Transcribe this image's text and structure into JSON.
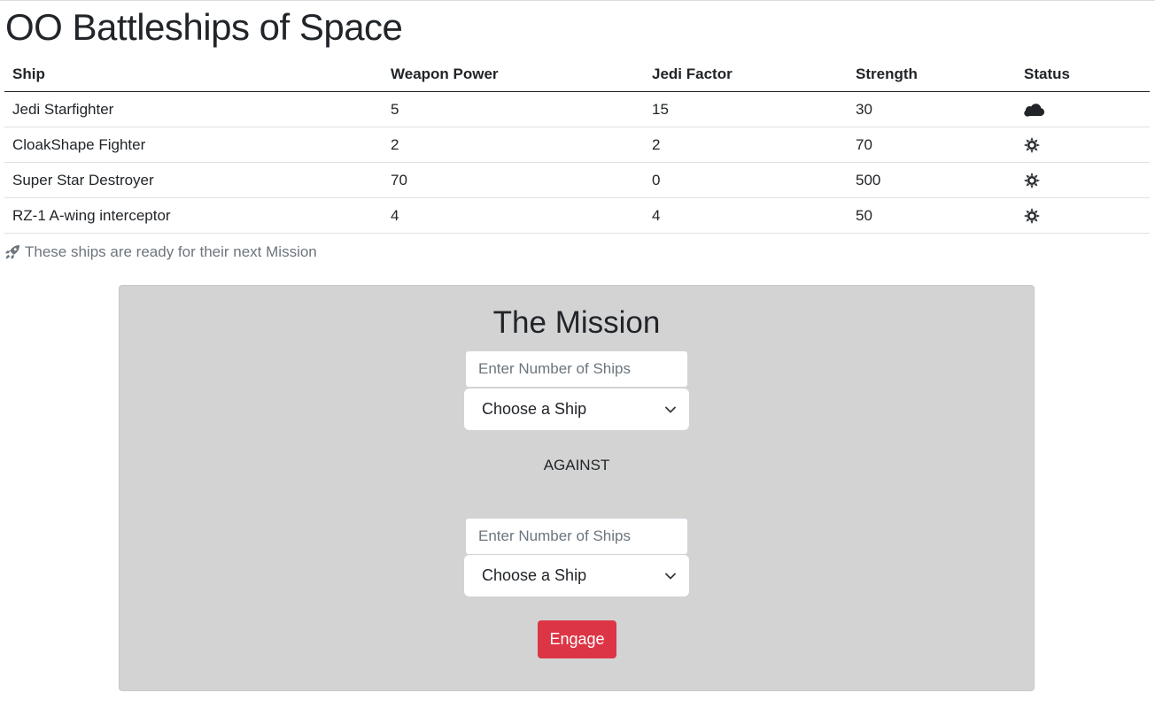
{
  "page": {
    "title": "OO Battleships of Space"
  },
  "table": {
    "headers": [
      "Ship",
      "Weapon Power",
      "Jedi Factor",
      "Strength",
      "Status"
    ],
    "rows": [
      {
        "ship": "Jedi Starfighter",
        "weapon_power": "5",
        "jedi_factor": "15",
        "strength": "30",
        "status_icon": "cloud-icon"
      },
      {
        "ship": "CloakShape Fighter",
        "weapon_power": "2",
        "jedi_factor": "2",
        "strength": "70",
        "status_icon": "sun-icon"
      },
      {
        "ship": "Super Star Destroyer",
        "weapon_power": "70",
        "jedi_factor": "0",
        "strength": "500",
        "status_icon": "sun-icon"
      },
      {
        "ship": "RZ-1 A-wing interceptor",
        "weapon_power": "4",
        "jedi_factor": "4",
        "strength": "50",
        "status_icon": "sun-icon"
      }
    ],
    "caption": "These ships are ready for their next Mission",
    "caption_icon": "rocket-icon"
  },
  "mission": {
    "title": "The Mission",
    "fleet1": {
      "number_placeholder": "Enter Number of Ships",
      "ship_select_value": "Choose a Ship"
    },
    "against_label": "AGAINST",
    "fleet2": {
      "number_placeholder": "Enter Number of Ships",
      "ship_select_value": "Choose a Ship"
    },
    "engage_label": "Engage"
  },
  "colors": {
    "mission_bg": "#d3d3d3",
    "engage_button": "#dc3545",
    "caption_text": "#6c757d"
  }
}
